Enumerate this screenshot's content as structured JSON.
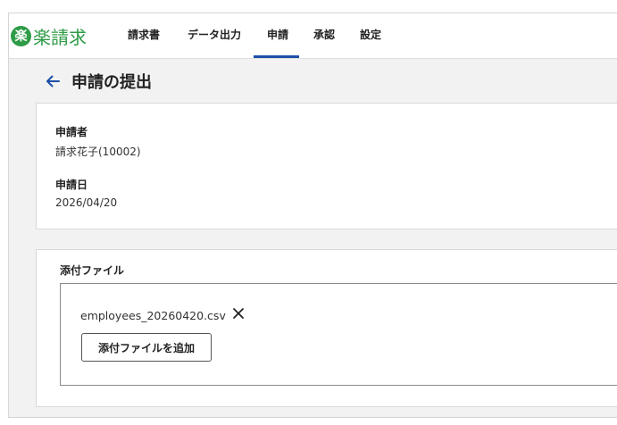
{
  "app": {
    "logo_badge": "楽",
    "logo_text": "楽請求",
    "brand_color": "#2e9b46",
    "accent_color": "#1c4fa8"
  },
  "nav": {
    "items": [
      {
        "label": "請求書"
      },
      {
        "label": "データ出力"
      },
      {
        "label": "申請",
        "active": true
      },
      {
        "label": "承認"
      },
      {
        "label": "設定"
      }
    ]
  },
  "page": {
    "title": "申請の提出",
    "back_icon": "arrow-left-icon"
  },
  "applicant": {
    "applicant_label": "申請者",
    "applicant_value": "請求花子(10002)",
    "date_label": "申請日",
    "date_value": "2026/04/20"
  },
  "attachments": {
    "section_label": "添付ファイル",
    "files": [
      {
        "name": "employees_20260420.csv",
        "remove_icon": "close-icon"
      }
    ],
    "add_button_label": "添付ファイルを追加"
  }
}
